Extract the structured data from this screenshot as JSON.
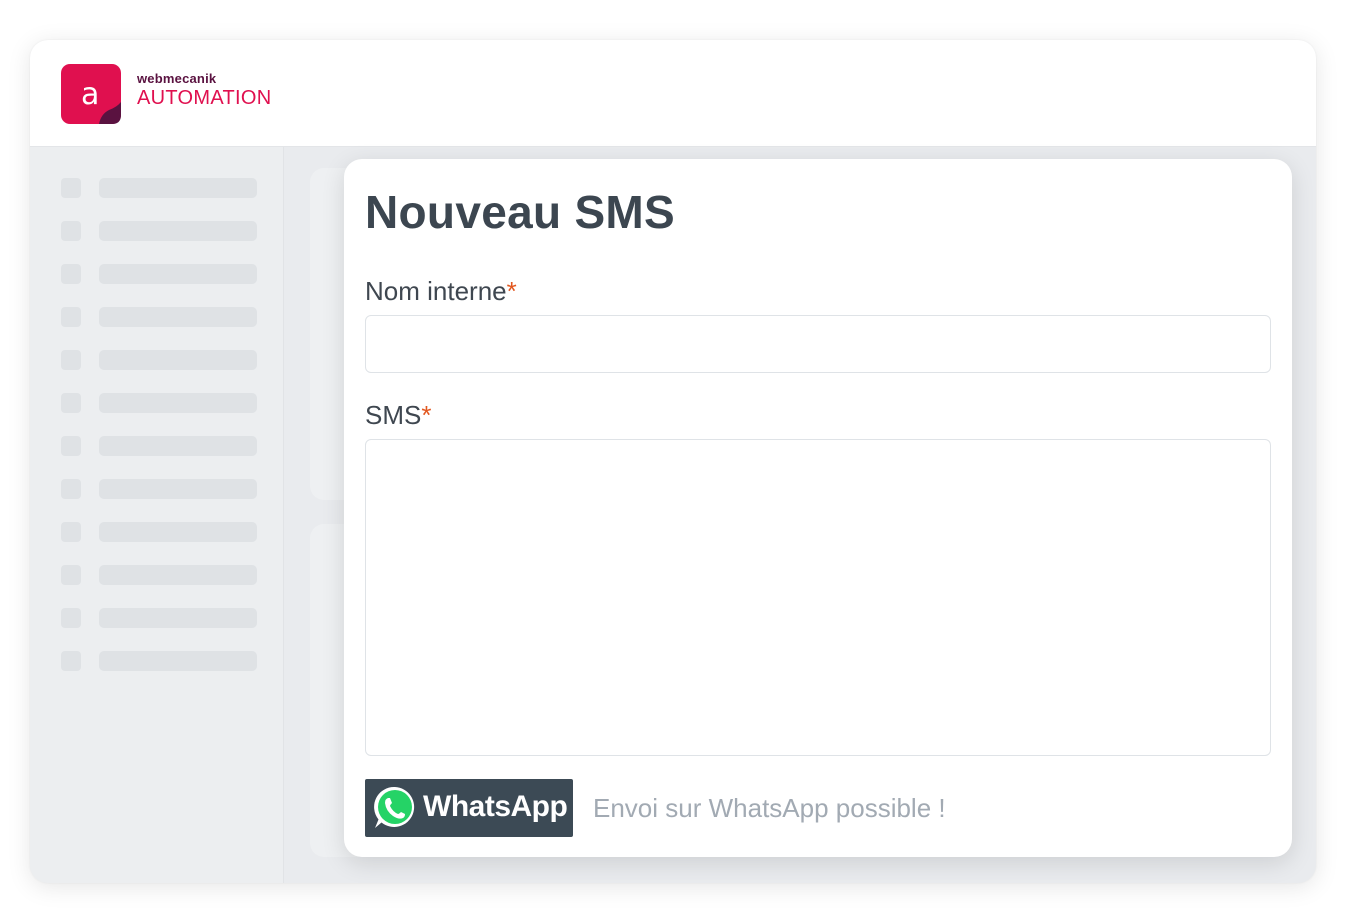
{
  "header": {
    "logo_icon": "webmecanik-a-logo-icon",
    "logo_mark_letter": "a",
    "brand_small": "webmecanik",
    "brand_big": "AUTOMATION",
    "brand_color": "#e0104f"
  },
  "sidebar": {
    "items": [
      {
        "placeholder": true
      },
      {
        "placeholder": true
      },
      {
        "placeholder": true
      },
      {
        "placeholder": true
      },
      {
        "placeholder": true
      },
      {
        "placeholder": true
      },
      {
        "placeholder": true
      },
      {
        "placeholder": true
      },
      {
        "placeholder": true
      },
      {
        "placeholder": true
      },
      {
        "placeholder": true
      },
      {
        "placeholder": true
      }
    ]
  },
  "form": {
    "title": "Nouveau SMS",
    "name_label": "Nom interne",
    "name_required": "*",
    "name_value": "",
    "sms_label": "SMS",
    "sms_required": "*",
    "sms_value": "",
    "whatsapp_badge": "WhatsApp",
    "whatsapp_icon": "whatsapp-icon",
    "whatsapp_note": "Envoi sur WhatsApp possible !"
  },
  "colors": {
    "required": "#e2571f",
    "whatsapp_green": "#25d366",
    "badge_bg": "#3c4a55"
  }
}
